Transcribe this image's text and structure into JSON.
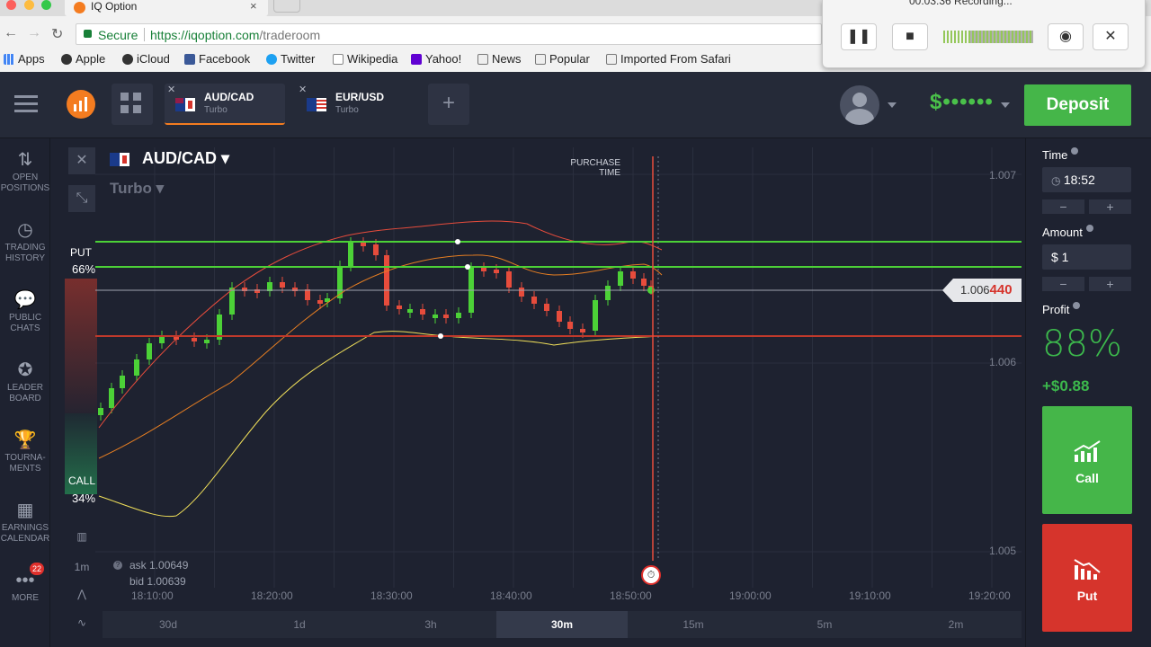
{
  "browser": {
    "tab_title": "IQ Option",
    "url_secure": "Secure",
    "url_host": "https://iqoption.com",
    "url_path": "/traderoom",
    "bookmarks": [
      "Apps",
      "Apple",
      "iCloud",
      "Facebook",
      "Twitter",
      "Wikipedia",
      "Yahoo!",
      "News",
      "Popular",
      "Imported From Safari"
    ]
  },
  "recorder": {
    "title": "00:03:36 Recording..."
  },
  "header": {
    "tabs": [
      {
        "symbol": "AUD/CAD",
        "type": "Turbo"
      },
      {
        "symbol": "EUR/USD",
        "type": "Turbo"
      }
    ],
    "balance": "$••••••",
    "deposit_label": "Deposit"
  },
  "leftnav": [
    {
      "label": "OPEN POSITIONS",
      "icon": "arrows-icon"
    },
    {
      "label": "TRADING HISTORY",
      "icon": "history-icon"
    },
    {
      "label": "PUBLIC CHATS",
      "icon": "chat-icon"
    },
    {
      "label": "LEADER BOARD",
      "icon": "medal-icon"
    },
    {
      "label": "TOURNA-MENTS",
      "icon": "trophy-icon"
    },
    {
      "label": "EARNINGS CALENDAR",
      "icon": "calendar-icon"
    },
    {
      "label": "MORE",
      "icon": "more-icon",
      "badge": "22"
    }
  ],
  "chart": {
    "pair": "AUD/CAD",
    "mode": "Turbo",
    "purchase_time_label": "PURCHASE TIME",
    "put_label": "PUT",
    "put_pct": "66%",
    "call_label": "CALL",
    "call_pct": "34%",
    "price_prefix": "1.006",
    "price_suffix": "440",
    "y_ticks": [
      "1.007",
      "1.006",
      "1.005"
    ],
    "x_ticks": [
      "18:10:00",
      "18:20:00",
      "18:30:00",
      "18:40:00",
      "18:50:00",
      "19:00:00",
      "19:10:00",
      "19:20:00"
    ],
    "ask": "ask 1.00649",
    "bid": "bid 1.00639",
    "candle_interval": "1m",
    "timeframes": [
      "30d",
      "1d",
      "3h",
      "30m",
      "15m",
      "5m",
      "2m"
    ],
    "active_timeframe": "30m"
  },
  "trade": {
    "time_label": "Time",
    "time_value": "18:52",
    "amount_label": "Amount",
    "amount_value": "$  1",
    "profit_label": "Profit",
    "profit_pct": "88%",
    "profit_amount": "+$0.88",
    "call_label": "Call",
    "put_label": "Put",
    "minus": "−",
    "plus": "+"
  },
  "colors": {
    "accent_green": "#45b649",
    "accent_red": "#d6342c",
    "brand_orange": "#f47c20",
    "background": "#1e2230"
  }
}
